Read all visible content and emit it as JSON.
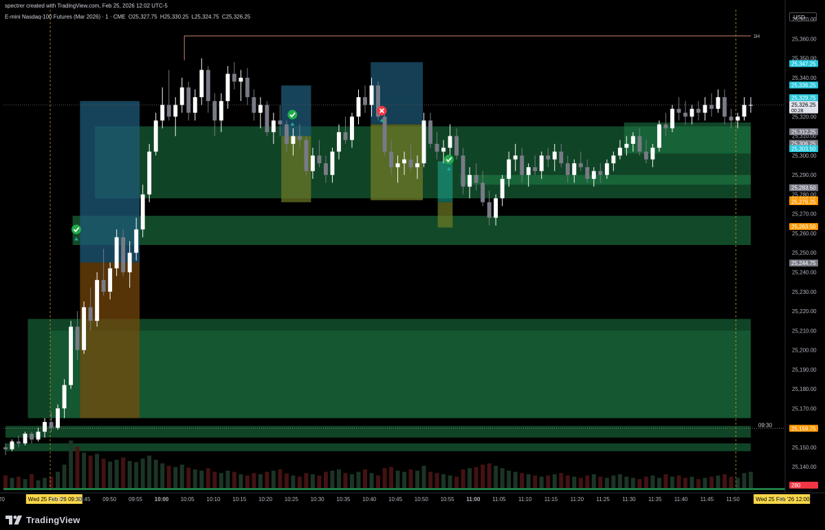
{
  "header": {
    "credit": "spectrer created with TradingView.com, Feb 25, 2026 12:02 UTC-5",
    "symbol_name": "E-mini Nasdaq-100 Futures (Mar 2026) · 1 · CME",
    "o_label": "O",
    "o_value": "25,327.75",
    "h_label": "H",
    "h_value": "25,330.25",
    "l_label": "L",
    "l_value": "25,324.75",
    "c_label": "C",
    "c_value": "25,326.25"
  },
  "currency_button": "USD",
  "branding": {
    "logo_text": "TradingView",
    "icon": "tradingview-logo-icon"
  },
  "colors": {
    "background": "#000000",
    "bull_candle": "#ffffff",
    "bear_candle": "#787b86",
    "zone_green": "#1e7c45",
    "zone_teal": "#1aa08a",
    "zone_blue": "#1d5a78",
    "zone_orange": "#7a4a0a",
    "zone_olive": "#6f7a25",
    "cyan_tag": "#26c6da",
    "orange_tag": "#ff9800",
    "gray_tag": "#787b86",
    "red_tag": "#f23645",
    "check_green": "#22ab4a",
    "cross_red": "#f23645",
    "session_line": "#c9a227"
  },
  "chart_data": {
    "type": "candlestick",
    "ylim": [
      25128,
      25375
    ],
    "y_ticks": [
      "25,370.00",
      "25,360.00",
      "25,350.00",
      "25,340.00",
      "25,330.00",
      "25,320.00",
      "25,310.00",
      "25,300.00",
      "25,290.00",
      "25,280.00",
      "25,270.00",
      "25,260.00",
      "25,250.00",
      "25,240.00",
      "25,230.00",
      "25,220.00",
      "25,210.00",
      "25,200.00",
      "25,190.00",
      "25,180.00",
      "25,170.00",
      "25,160.00",
      "25,150.00",
      "25,140.00",
      "25,130.00"
    ],
    "x_ticks": [
      "20",
      "Wed 25 Feb '26  09:30",
      "09:40",
      "09:45",
      "09:50",
      "09:55",
      "10:00",
      "10:05",
      "10:10",
      "10:15",
      "10:20",
      "10:25",
      "10:30",
      "10:35",
      "10:40",
      "10:45",
      "10:50",
      "10:55",
      "11:00",
      "11:05",
      "11:10",
      "11:15",
      "11:20",
      "11:25",
      "11:30",
      "11:35",
      "11:40",
      "11:45",
      "11:50",
      "Wed 25 Feb '26  12:00",
      "12"
    ],
    "price_tags": [
      {
        "label": "25,347.25",
        "value": 25347.25,
        "color": "#26c6da"
      },
      {
        "label": "25,336.25",
        "value": 25336.25,
        "color": "#26c6da"
      },
      {
        "label": "25,329.75",
        "value": 25329.75,
        "color": "#26c6da"
      },
      {
        "label": "25,326.25",
        "value": 25326.25,
        "color": "#e0e3eb",
        "sub": "00:28"
      },
      {
        "label": "25,312.25",
        "value": 25312.25,
        "color": "#787b86"
      },
      {
        "label": "25,306.25",
        "value": 25306.25,
        "color": "#787b86"
      },
      {
        "label": "25,303.50",
        "value": 25303.5,
        "color": "#26c6da"
      },
      {
        "label": "25,283.50",
        "value": 25283.5,
        "color": "#787b86"
      },
      {
        "label": "25,277.25",
        "value": 25277.25,
        "color": "#ff9800"
      },
      {
        "label": "25,276.25",
        "value": 25276.25,
        "color": "#ff9800"
      },
      {
        "label": "25,263.50",
        "value": 25263.5,
        "color": "#ff9800"
      },
      {
        "label": "25,244.75",
        "value": 25244.75,
        "color": "#787b86"
      },
      {
        "label": "25,159.75",
        "value": 25159.75,
        "color": "#ff9800"
      },
      {
        "label": "280",
        "value": 25130.5,
        "color": "#f23645"
      }
    ],
    "annotations": [
      {
        "text": "1H",
        "value": 25361.5
      },
      {
        "text": "09:30",
        "value": 25159.75
      }
    ],
    "candles": [
      [
        25150,
        25152,
        25146,
        25149
      ],
      [
        25149,
        25154,
        25148,
        25153
      ],
      [
        25153,
        25156,
        25150,
        25152
      ],
      [
        25152,
        25158,
        25151,
        25157
      ],
      [
        25157,
        25158,
        25152,
        25154
      ],
      [
        25154,
        25160,
        25153,
        25158
      ],
      [
        25158,
        25165,
        25155,
        25163
      ],
      [
        25163,
        25168,
        25158,
        25160
      ],
      [
        25160,
        25172,
        25159,
        25170
      ],
      [
        25170,
        25185,
        25165,
        25182
      ],
      [
        25182,
        25215,
        25180,
        25212
      ],
      [
        25212,
        25220,
        25195,
        25200
      ],
      [
        25200,
        25225,
        25198,
        25222
      ],
      [
        25222,
        25232,
        25210,
        25215
      ],
      [
        25215,
        25240,
        25212,
        25236
      ],
      [
        25236,
        25252,
        25228,
        25230
      ],
      [
        25230,
        25245,
        25226,
        25242
      ],
      [
        25242,
        25262,
        25238,
        25258
      ],
      [
        25258,
        25262,
        25238,
        25240
      ],
      [
        25240,
        25256,
        25232,
        25250
      ],
      [
        25250,
        25268,
        25246,
        25262
      ],
      [
        25262,
        25285,
        25258,
        25280
      ],
      [
        25280,
        25306,
        25276,
        25302
      ],
      [
        25302,
        25322,
        25300,
        25318
      ],
      [
        25318,
        25335,
        25314,
        25326
      ],
      [
        25326,
        25344,
        25318,
        25320
      ],
      [
        25320,
        25330,
        25310,
        25326
      ],
      [
        25326,
        25340,
        25322,
        25335
      ],
      [
        25335,
        25338,
        25318,
        25322
      ],
      [
        25322,
        25334,
        25318,
        25330
      ],
      [
        25330,
        25350,
        25326,
        25344
      ],
      [
        25344,
        25346,
        25322,
        25328
      ],
      [
        25328,
        25332,
        25310,
        25318
      ],
      [
        25318,
        25332,
        25312,
        25328
      ],
      [
        25328,
        25346,
        25324,
        25342
      ],
      [
        25342,
        25348,
        25334,
        25338
      ],
      [
        25338,
        25344,
        25328,
        25340
      ],
      [
        25340,
        25345,
        25326,
        25330
      ],
      [
        25330,
        25334,
        25318,
        25322
      ],
      [
        25322,
        25330,
        25314,
        25326
      ],
      [
        25326,
        25328,
        25310,
        25312
      ],
      [
        25312,
        25322,
        25306,
        25318
      ],
      [
        25318,
        25326,
        25310,
        25316
      ],
      [
        25316,
        25318,
        25302,
        25306
      ],
      [
        25306,
        25314,
        25300,
        25310
      ],
      [
        25310,
        25316,
        25304,
        25308
      ],
      [
        25308,
        25310,
        25290,
        25292
      ],
      [
        25292,
        25304,
        25288,
        25300
      ],
      [
        25300,
        25308,
        25294,
        25296
      ],
      [
        25296,
        25300,
        25286,
        25290
      ],
      [
        25290,
        25304,
        25286,
        25302
      ],
      [
        25302,
        25316,
        25298,
        25312
      ],
      [
        25312,
        25320,
        25306,
        25308
      ],
      [
        25308,
        25322,
        25304,
        25320
      ],
      [
        25320,
        25334,
        25316,
        25330
      ],
      [
        25330,
        25336,
        25322,
        25326
      ],
      [
        25326,
        25340,
        25320,
        25336
      ],
      [
        25336,
        25338,
        25318,
        25320
      ],
      [
        25320,
        25324,
        25300,
        25302
      ],
      [
        25302,
        25308,
        25290,
        25294
      ],
      [
        25294,
        25300,
        25286,
        25296
      ],
      [
        25296,
        25302,
        25290,
        25298
      ],
      [
        25298,
        25306,
        25292,
        25294
      ],
      [
        25294,
        25300,
        25288,
        25296
      ],
      [
        25296,
        25322,
        25294,
        25318
      ],
      [
        25318,
        25322,
        25304,
        25306
      ],
      [
        25306,
        25312,
        25298,
        25302
      ],
      [
        25302,
        25308,
        25296,
        25304
      ],
      [
        25304,
        25316,
        25300,
        25310
      ],
      [
        25310,
        25314,
        25298,
        25300
      ],
      [
        25300,
        25304,
        25280,
        25284
      ],
      [
        25284,
        25294,
        25278,
        25290
      ],
      [
        25290,
        25296,
        25282,
        25286
      ],
      [
        25286,
        25292,
        25274,
        25276
      ],
      [
        25276,
        25282,
        25264,
        25268
      ],
      [
        25268,
        25280,
        25264,
        25278
      ],
      [
        25278,
        25290,
        25274,
        25288
      ],
      [
        25288,
        25302,
        25284,
        25298
      ],
      [
        25298,
        25306,
        25292,
        25300
      ],
      [
        25300,
        25304,
        25286,
        25290
      ],
      [
        25290,
        25296,
        25284,
        25294
      ],
      [
        25294,
        25300,
        25290,
        25292
      ],
      [
        25292,
        25302,
        25288,
        25300
      ],
      [
        25300,
        25304,
        25294,
        25298
      ],
      [
        25298,
        25306,
        25292,
        25302
      ],
      [
        25302,
        25306,
        25294,
        25296
      ],
      [
        25296,
        25300,
        25286,
        25290
      ],
      [
        25290,
        25298,
        25286,
        25296
      ],
      [
        25296,
        25302,
        25292,
        25294
      ],
      [
        25294,
        25298,
        25286,
        25288
      ],
      [
        25288,
        25294,
        25284,
        25292
      ],
      [
        25292,
        25296,
        25286,
        25290
      ],
      [
        25290,
        25298,
        25288,
        25296
      ],
      [
        25296,
        25302,
        25292,
        25300
      ],
      [
        25300,
        25308,
        25298,
        25304
      ],
      [
        25304,
        25310,
        25300,
        25306
      ],
      [
        25306,
        25312,
        25302,
        25310
      ],
      [
        25310,
        25314,
        25300,
        25302
      ],
      [
        25302,
        25308,
        25296,
        25298
      ],
      [
        25298,
        25306,
        25294,
        25304
      ],
      [
        25304,
        25318,
        25302,
        25316
      ],
      [
        25316,
        25322,
        25310,
        25314
      ],
      [
        25314,
        25326,
        25312,
        25324
      ],
      [
        25324,
        25330,
        25318,
        25322
      ],
      [
        25322,
        25328,
        25316,
        25320
      ],
      [
        25320,
        25326,
        25316,
        25324
      ],
      [
        25324,
        25328,
        25318,
        25322
      ],
      [
        25322,
        25330,
        25318,
        25326
      ],
      [
        25326,
        25332,
        25320,
        25324
      ],
      [
        25324,
        25334,
        25322,
        25330
      ],
      [
        25330,
        25334,
        25316,
        25320
      ],
      [
        25320,
        25324,
        25314,
        25318
      ],
      [
        25318,
        25322,
        25314,
        25320
      ],
      [
        25320,
        25330,
        25318,
        25326
      ],
      [
        25326,
        25330,
        25322,
        25326
      ]
    ],
    "volumes": [
      22,
      18,
      20,
      16,
      24,
      14,
      18,
      20,
      28,
      40,
      80,
      70,
      60,
      55,
      58,
      50,
      45,
      48,
      52,
      46,
      44,
      50,
      55,
      48,
      42,
      38,
      36,
      40,
      35,
      32,
      30,
      34,
      28,
      26,
      30,
      28,
      24,
      22,
      26,
      24,
      28,
      30,
      32,
      25,
      22,
      20,
      26,
      24,
      22,
      28,
      30,
      32,
      26,
      24,
      28,
      32,
      26,
      22,
      34,
      36,
      30,
      28,
      32,
      30,
      38,
      28,
      26,
      24,
      22,
      20,
      32,
      34,
      36,
      40,
      42,
      38,
      34,
      30,
      28,
      26,
      24,
      22,
      20,
      22,
      24,
      26,
      22,
      20,
      18,
      22,
      24,
      20,
      18,
      22,
      24,
      20,
      18,
      16,
      20,
      22,
      18,
      24,
      20,
      22,
      18,
      20,
      16,
      18,
      20,
      22,
      24,
      20,
      18,
      26,
      28
    ]
  }
}
